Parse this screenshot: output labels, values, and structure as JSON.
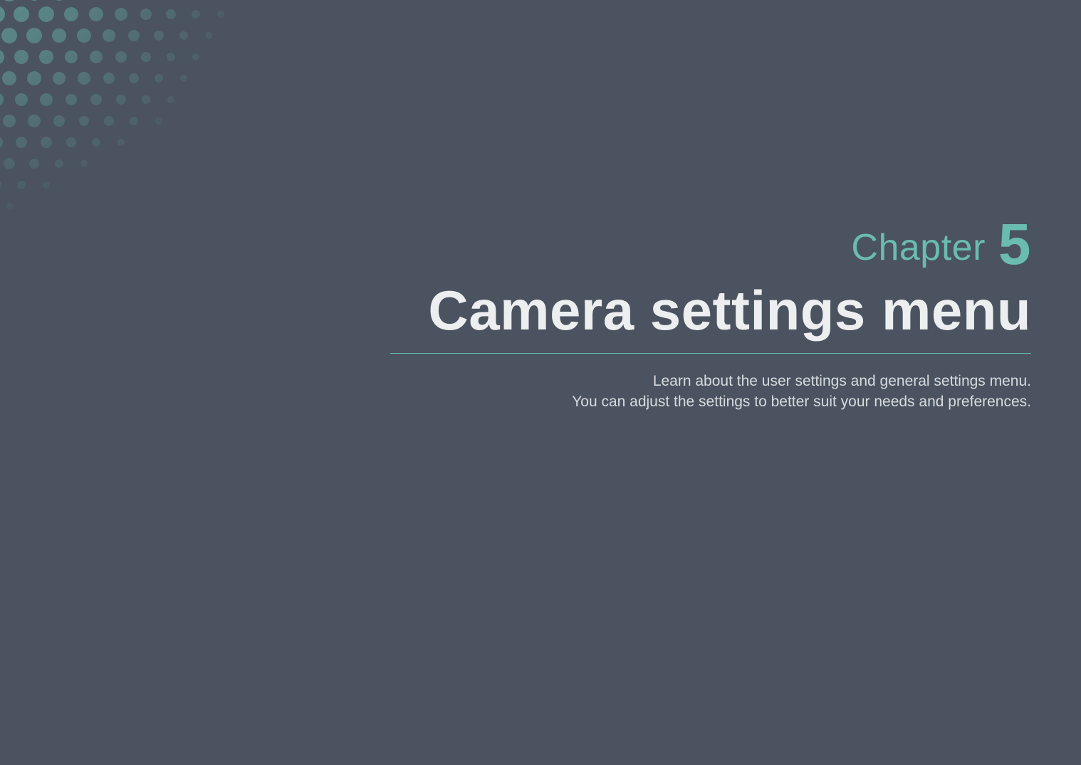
{
  "chapter": {
    "label": "Chapter",
    "number": "5",
    "title": "Camera settings menu",
    "description_line1": "Learn about the user settings and general settings menu.",
    "description_line2": "You can adjust the settings to better suit your needs and preferences."
  },
  "colors": {
    "background": "#4a535f",
    "accent": "#6bbcb0",
    "title": "#eceef0",
    "body": "#d7dbdf"
  }
}
